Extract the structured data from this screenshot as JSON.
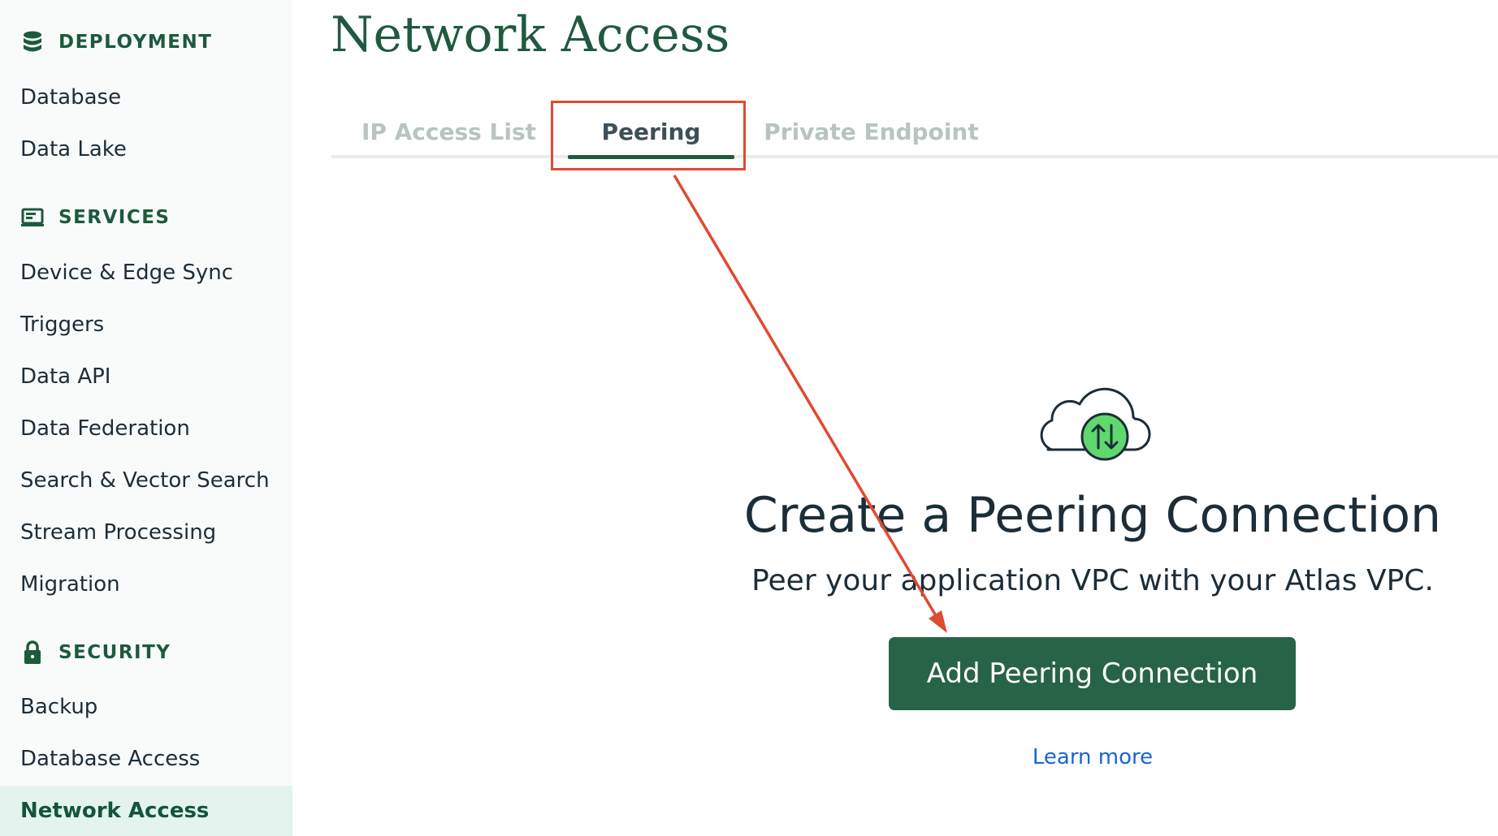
{
  "sidebar": {
    "deployment": {
      "header": "DEPLOYMENT",
      "icon": "database-icon",
      "items": [
        "Database",
        "Data Lake"
      ]
    },
    "services": {
      "header": "SERVICES",
      "icon": "services-icon",
      "items": [
        "Device & Edge Sync",
        "Triggers",
        "Data API",
        "Data Federation",
        "Search & Vector Search",
        "Stream Processing",
        "Migration"
      ]
    },
    "security": {
      "header": "SECURITY",
      "icon": "lock-icon",
      "items": [
        "Backup",
        "Database Access",
        "Network Access"
      ],
      "active": "Network Access"
    }
  },
  "main": {
    "title": "Network Access",
    "tabs": [
      {
        "label": "IP Access List",
        "active": false
      },
      {
        "label": "Peering",
        "active": true
      },
      {
        "label": "Private Endpoint",
        "active": false
      }
    ],
    "empty_state": {
      "icon": "cloud-transfer-icon",
      "title": "Create a Peering Connection",
      "description": "Peer your application VPC with your Atlas VPC.",
      "button_label": "Add Peering Connection",
      "link_label": "Learn more"
    }
  },
  "colors": {
    "brand_green": "#1f5a3f",
    "button_green": "#276346",
    "active_bg": "#e3f4ef",
    "link_blue": "#1a64d6",
    "annotation_red": "#e04a30"
  }
}
